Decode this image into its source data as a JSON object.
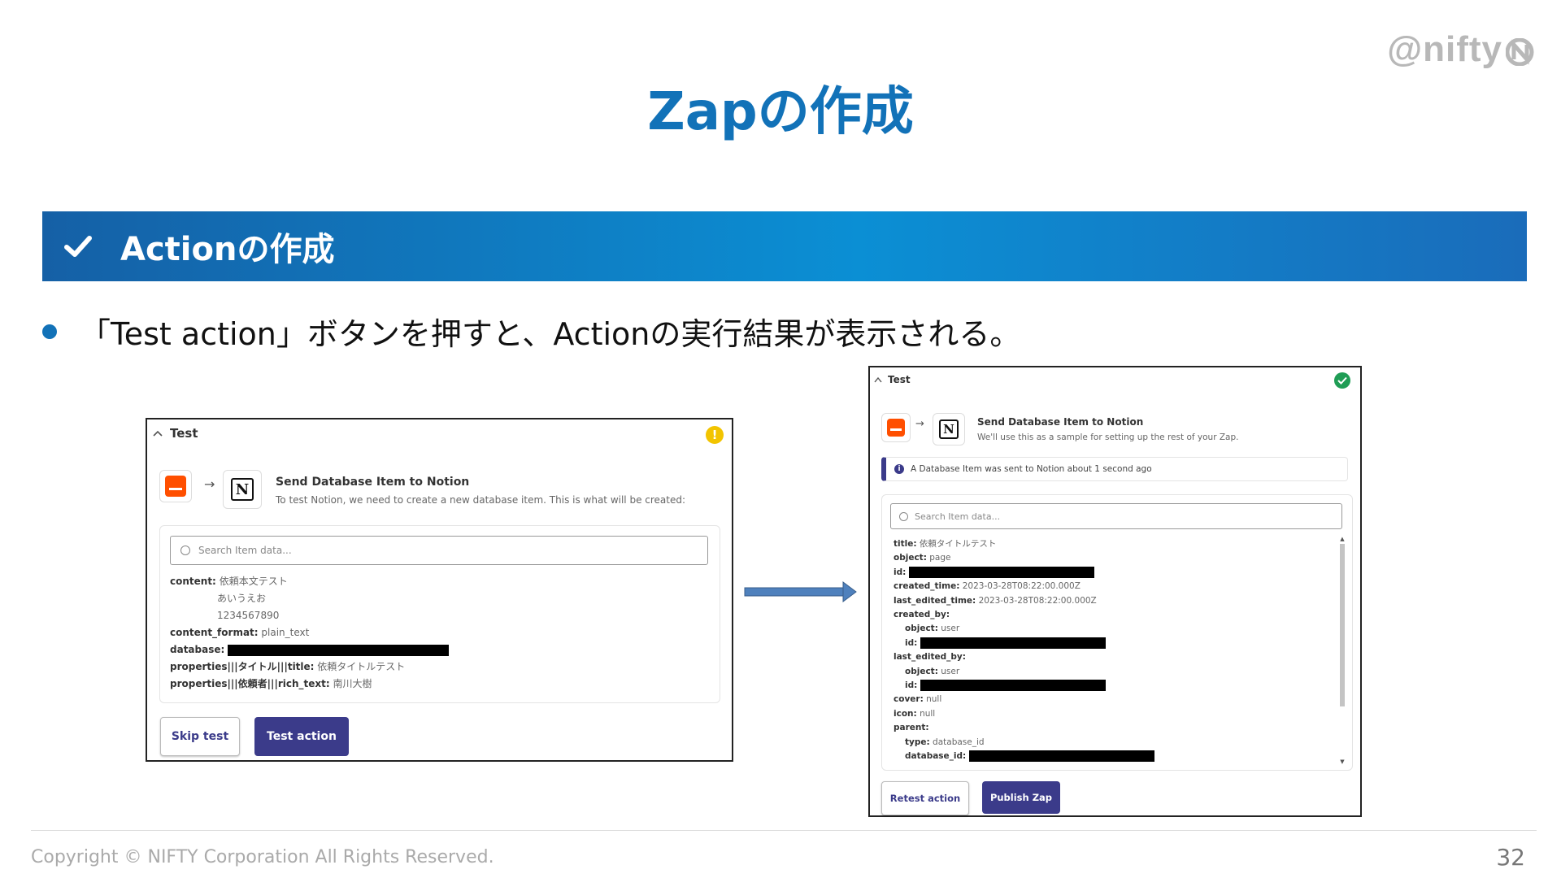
{
  "brand": {
    "logo_text": "@nifty"
  },
  "slide": {
    "title": "Zapの作成",
    "section_heading": "Actionの作成",
    "bullet": "「Test action」ボタンを押すと、Actionの実行結果が表示される。",
    "copyright": "Copyright © NIFTY Corporation All Rights Reserved.",
    "page_number": "32",
    "accent_color": "#1272b8"
  },
  "before": {
    "header": "Test",
    "status": "warning",
    "step_title": "Send Database Item to Notion",
    "step_desc": "To test Notion, we need to create a new database item. This is what will be created:",
    "search_placeholder": "Search Item data...",
    "fields": [
      {
        "key": "content:",
        "value": "依頼本文テスト"
      },
      {
        "key": "",
        "value": "あいうえお"
      },
      {
        "key": "",
        "value": "1234567890"
      },
      {
        "key": "content_format:",
        "value": "plain_text"
      },
      {
        "key": "database:",
        "value": ""
      },
      {
        "key": "properties|||タイトル|||title:",
        "value": "依頼タイトルテスト"
      },
      {
        "key": "properties|||依頼者|||rich_text:",
        "value": "南川大樹"
      }
    ],
    "skip_label": "Skip test",
    "test_label": "Test action"
  },
  "after": {
    "header": "Test",
    "status": "success",
    "step_title": "Send Database Item to Notion",
    "step_desc": "We'll use this as a sample for setting up the rest of your Zap.",
    "notice": "A Database Item was sent to Notion about 1 second ago",
    "search_placeholder": "Search Item data...",
    "fields": [
      {
        "key": "title:",
        "value": "依頼タイトルテスト"
      },
      {
        "key": "object:",
        "value": "page"
      },
      {
        "key": "id:",
        "value": ""
      },
      {
        "key": "created_time:",
        "value": "2023-03-28T08:22:00.000Z"
      },
      {
        "key": "last_edited_time:",
        "value": "2023-03-28T08:22:00.000Z"
      },
      {
        "key": "created_by:",
        "value": ""
      },
      {
        "key": "object:",
        "value": "user"
      },
      {
        "key": "id:",
        "value": ""
      },
      {
        "key": "last_edited_by:",
        "value": ""
      },
      {
        "key": "object:",
        "value": "user"
      },
      {
        "key": "id:",
        "value": ""
      },
      {
        "key": "cover:",
        "value": "null"
      },
      {
        "key": "icon:",
        "value": "null"
      },
      {
        "key": "parent:",
        "value": ""
      },
      {
        "key": "type:",
        "value": "database_id"
      },
      {
        "key": "database_id:",
        "value": ""
      }
    ],
    "retest_label": "Retest action",
    "publish_label": "Publish Zap"
  }
}
